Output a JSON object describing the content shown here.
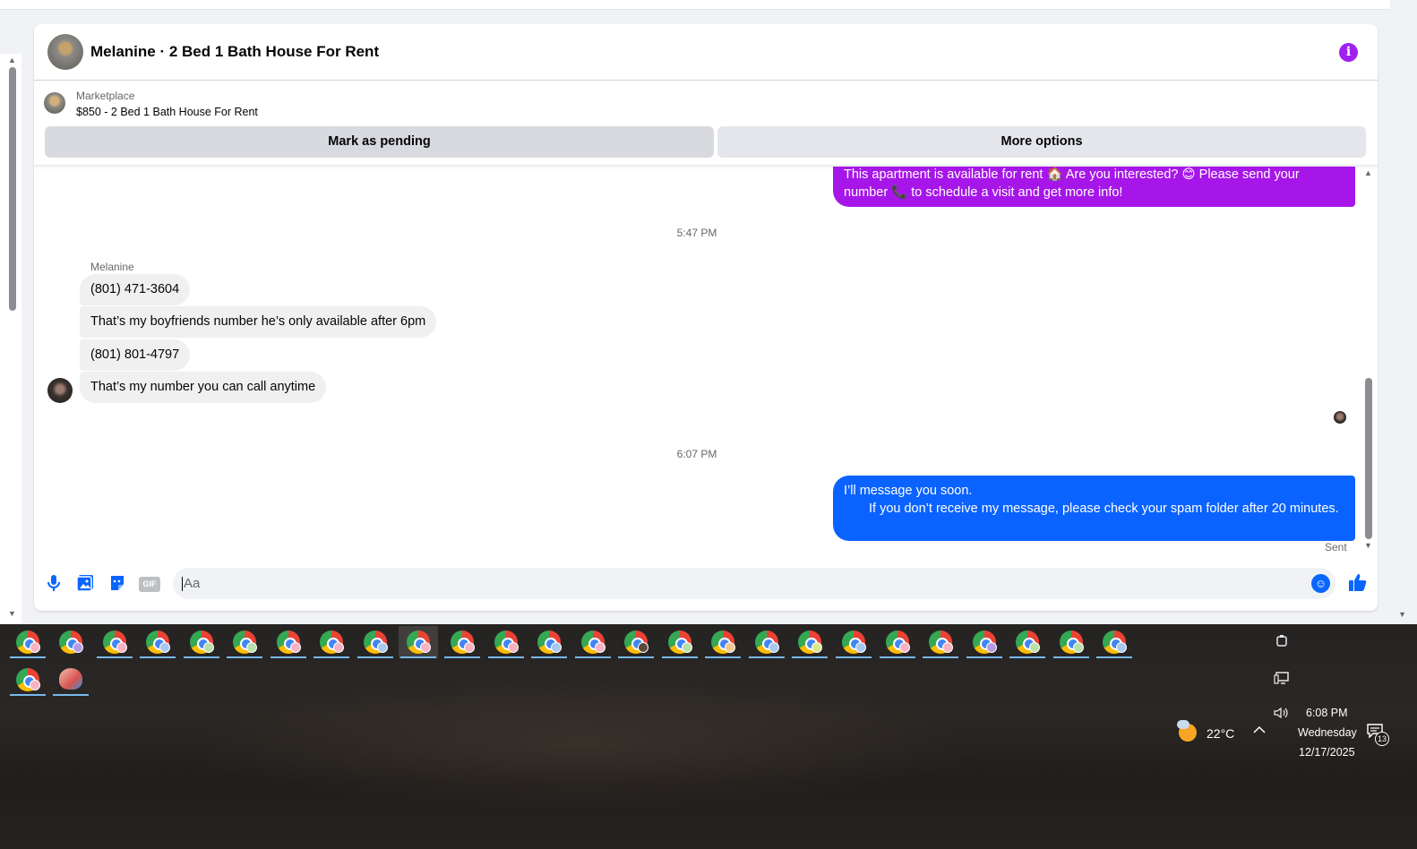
{
  "conversation": {
    "title": "Melanine · 2 Bed 1 Bath House For Rent",
    "listing": {
      "label": "Marketplace",
      "price_title": "$850 - 2 Bed 1 Bath House For Rent"
    },
    "buttons": {
      "mark_pending": "Mark as pending",
      "more_options": "More options"
    }
  },
  "messages": {
    "outgoing_1": "This apartment is available for rent 🏠 Are you interested? 😊 Please send your number 📞 to schedule a visit and get more info!",
    "timestamp_1": "5:47 PM",
    "sender_name": "Melanine",
    "incoming": [
      "(801) 471-3604",
      "That’s my boyfriends number he’s only available after 6pm",
      "(801) 801-4797",
      "That’s my number you can call anytime"
    ],
    "timestamp_2": "6:07 PM",
    "outgoing_2_line1": "I’ll message you soon.",
    "outgoing_2_line2": "If you don’t receive my message, please check your spam folder after 20 minutes.",
    "status": "Sent"
  },
  "composer": {
    "placeholder": "Aa",
    "gif_label": "GIF"
  },
  "taskbar": {
    "weather_temp": "22°C",
    "time": "6:08 PM",
    "day": "Wednesday",
    "date": "12/17/2025",
    "notification_count": "13"
  },
  "colors": {
    "outgoing_purple": "#a616e8",
    "outgoing_blue": "#0a63ff",
    "accent": "#0866ff",
    "info_icon": "#a020f0"
  }
}
